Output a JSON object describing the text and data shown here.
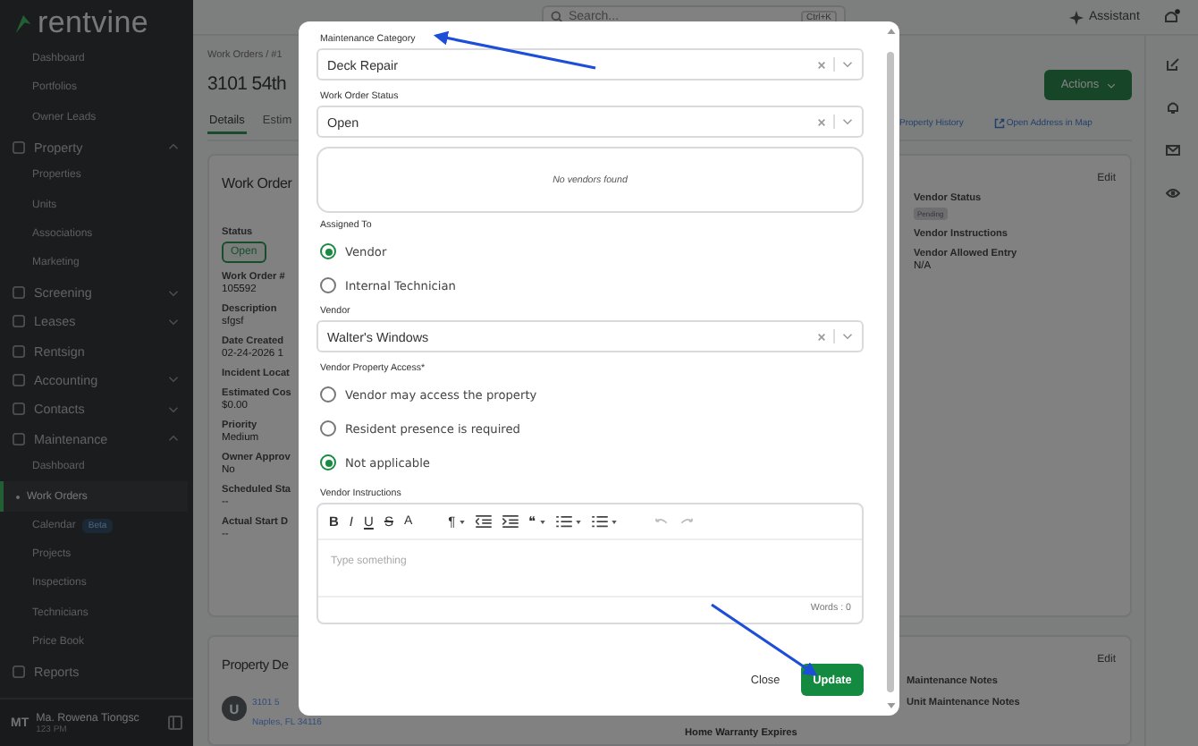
{
  "sidebar": {
    "logo": "rentvine",
    "items": [
      {
        "kind": "sub",
        "label": "Dashboard",
        "selected": false
      },
      {
        "kind": "sub",
        "label": "Portfolios",
        "selected": false
      },
      {
        "kind": "sub",
        "label": "Owner Leads",
        "selected": false
      },
      {
        "kind": "group",
        "label": "Property",
        "expanded": true,
        "selected": false,
        "children": [
          {
            "kind": "sub",
            "label": "Properties",
            "selected": false
          },
          {
            "kind": "sub",
            "label": "Units",
            "selected": false
          },
          {
            "kind": "sub",
            "label": "Associations",
            "selected": false
          },
          {
            "kind": "sub",
            "label": "Marketing",
            "selected": false
          }
        ]
      },
      {
        "kind": "group",
        "label": "Screening",
        "expanded": false,
        "selected": false
      },
      {
        "kind": "group",
        "label": "Leases",
        "expanded": false,
        "selected": false
      },
      {
        "kind": "link",
        "label": "Rentsign",
        "selected": false
      },
      {
        "kind": "group",
        "label": "Accounting",
        "expanded": false,
        "selected": false
      },
      {
        "kind": "group",
        "label": "Contacts",
        "expanded": false,
        "selected": false
      },
      {
        "kind": "group",
        "label": "Maintenance",
        "expanded": true,
        "selected": false,
        "children": [
          {
            "kind": "sub",
            "label": "Dashboard",
            "selected": false
          },
          {
            "kind": "sub",
            "label": "Work Orders",
            "selected": true
          },
          {
            "kind": "sub",
            "label": "Calendar",
            "badge": "Beta",
            "selected": false
          },
          {
            "kind": "sub",
            "label": "Projects",
            "selected": false
          },
          {
            "kind": "sub",
            "label": "Inspections",
            "selected": false
          },
          {
            "kind": "sub",
            "label": "Technicians",
            "selected": false
          },
          {
            "kind": "sub",
            "label": "Price Book",
            "selected": false
          }
        ]
      },
      {
        "kind": "link",
        "label": "Reports",
        "selected": false
      }
    ],
    "user": {
      "initials": "MT",
      "name": "Ma. Rowena Tiongsc",
      "time": "123 PM"
    }
  },
  "topbar": {
    "search": {
      "placeholder": "Search...",
      "shortcut": "Ctrl+K"
    },
    "assistant": "Assistant",
    "notification_dot": true
  },
  "page": {
    "breadcrumb": "Work Orders / #1",
    "title": "3101 54th",
    "tabs": [
      {
        "label": "Details",
        "selected": true
      },
      {
        "label": "Estim",
        "selected": false
      }
    ],
    "actions": "Actions",
    "links": [
      "Property History",
      "Open Address in Map"
    ],
    "card": {
      "title": "Work Order",
      "status_label": "Status",
      "status": "Open",
      "fields": [
        {
          "label": "Work Order #",
          "value": "105592"
        },
        {
          "label": "Description",
          "value": "sfgsf"
        },
        {
          "label": "Date Created",
          "value": "02-24-2026 1"
        },
        {
          "label": "Incident Locat"
        },
        {
          "label": "Estimated Cos",
          "value": "$0.00"
        },
        {
          "label": "Priority",
          "value": "Medium"
        },
        {
          "label": "Owner Approv",
          "value": "No"
        },
        {
          "label": "Scheduled Sta",
          "value": "--"
        },
        {
          "label": "Actual Start D",
          "value": "--"
        }
      ],
      "edit": "Edit",
      "right_fields": [
        {
          "label": "Vendor Status",
          "badge": "Pending"
        },
        {
          "label": "Vendor Instructions"
        },
        {
          "label": "Vendor Allowed Entry",
          "value": "N/A"
        }
      ]
    },
    "card2": {
      "title": "Property De",
      "avatar": "U",
      "address": [
        "3101 5",
        "Naples, FL 34116"
      ],
      "edit": "Edit",
      "middle": "Home Warranty Expires",
      "right": [
        "Maintenance Notes",
        "Unit Maintenance Notes"
      ]
    }
  },
  "modal": {
    "fields": [
      {
        "kind": "select",
        "label": "Maintenance Category",
        "value": "Deck Repair"
      },
      {
        "kind": "select",
        "label": "Work Order Status",
        "value": "Open"
      },
      {
        "kind": "notice",
        "text": "No vendors found"
      },
      {
        "kind": "radio",
        "label": "Assigned To",
        "options": [
          {
            "label": "Vendor",
            "selected": true
          },
          {
            "label": "Internal Technician",
            "selected": false
          }
        ]
      },
      {
        "kind": "select",
        "label": "Vendor",
        "value": "Walter's Windows"
      },
      {
        "kind": "radio",
        "label": "Vendor Property Access",
        "required_mark": "*",
        "options": [
          {
            "label": "Vendor may access the property",
            "selected": false
          },
          {
            "label": "Resident presence is required",
            "selected": false
          },
          {
            "label": "Not applicable",
            "selected": true
          }
        ]
      },
      {
        "kind": "editor",
        "label": "Vendor Instructions",
        "placeholder": "Type something",
        "word_count": "Words : 0",
        "tools": [
          {
            "kind": "bold",
            "glyph": "B",
            "dropdown": false,
            "disabled": false
          },
          {
            "kind": "italic",
            "glyph": "I",
            "dropdown": false,
            "disabled": false
          },
          {
            "kind": "underline",
            "glyph": "U",
            "dropdown": false,
            "disabled": false
          },
          {
            "kind": "strike",
            "glyph": "S",
            "dropdown": false,
            "disabled": false
          },
          {
            "kind": "clear",
            "glyph": "A",
            "dropdown": false,
            "disabled": false
          },
          {
            "kind": "paragraph",
            "glyph": "¶",
            "dropdown": true,
            "disabled": false
          },
          {
            "kind": "outdent",
            "dropdown": false,
            "disabled": false
          },
          {
            "kind": "indent",
            "dropdown": false,
            "disabled": false
          },
          {
            "kind": "quote",
            "glyph": "❝",
            "dropdown": true,
            "disabled": false
          },
          {
            "kind": "ordered-list",
            "dropdown": true,
            "disabled": false
          },
          {
            "kind": "bullet-list",
            "dropdown": true,
            "disabled": false
          },
          {
            "kind": "undo",
            "dropdown": false,
            "disabled": true
          },
          {
            "kind": "redo",
            "dropdown": false,
            "disabled": true
          }
        ]
      }
    ],
    "buttons": [
      {
        "kind": "text",
        "label": "Close"
      },
      {
        "kind": "primary",
        "label": "Update"
      }
    ]
  }
}
